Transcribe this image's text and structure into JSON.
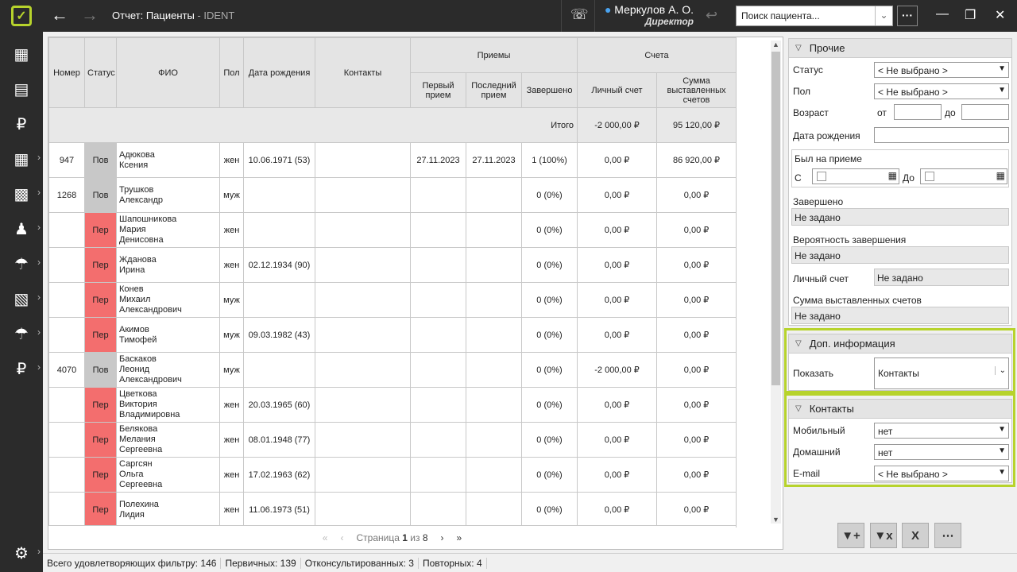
{
  "app": {
    "title": "Отчет: Пациенты",
    "subtitle": " - IDENT",
    "user_name": "Меркулов А. О.",
    "user_role": "Директор",
    "search_placeholder": "Поиск пациента...",
    "more_label": "···"
  },
  "grid": {
    "headers": {
      "num": "Номер",
      "status": "Статус",
      "fio": "ФИО",
      "sex": "Пол",
      "dob": "Дата рождения",
      "contacts": "Контакты",
      "visits": "Приемы",
      "first": "Первый прием",
      "last": "Последний прием",
      "done": "Завершено",
      "bills": "Счета",
      "account": "Личный счет",
      "sum": "Сумма выставленных счетов"
    },
    "total": {
      "label": "Итого",
      "account": "-2 000,00 ₽",
      "sum": "95 120,00 ₽"
    },
    "rows": [
      {
        "num": "947",
        "status": "Пов",
        "type": "pov",
        "fio": "Адюкова\nКсения",
        "sex": "жен",
        "dob": "10.06.1971 (53)",
        "first": "27.11.2023",
        "last": "27.11.2023",
        "done": "1 (100%)",
        "account": "0,00 ₽",
        "sum": "86 920,00 ₽"
      },
      {
        "num": "1268",
        "status": "Пов",
        "type": "pov",
        "fio": "Трушков\nАлександр",
        "sex": "муж",
        "dob": "",
        "first": "",
        "last": "",
        "done": "0 (0%)",
        "account": "0,00 ₽",
        "sum": "0,00 ₽"
      },
      {
        "num": "",
        "status": "Пер",
        "type": "per",
        "fio": "Шапошникова\nМария\nДенисовна",
        "sex": "жен",
        "dob": "",
        "first": "",
        "last": "",
        "done": "0 (0%)",
        "account": "0,00 ₽",
        "sum": "0,00 ₽"
      },
      {
        "num": "",
        "status": "Пер",
        "type": "per",
        "fio": "Жданова\nИрина",
        "sex": "жен",
        "dob": "02.12.1934 (90)",
        "first": "",
        "last": "",
        "done": "0 (0%)",
        "account": "0,00 ₽",
        "sum": "0,00 ₽"
      },
      {
        "num": "",
        "status": "Пер",
        "type": "per",
        "fio": "Конев\nМихаил\nАлександрович",
        "sex": "муж",
        "dob": "",
        "first": "",
        "last": "",
        "done": "0 (0%)",
        "account": "0,00 ₽",
        "sum": "0,00 ₽"
      },
      {
        "num": "",
        "status": "Пер",
        "type": "per",
        "fio": "Акимов\nТимофей",
        "sex": "муж",
        "dob": "09.03.1982 (43)",
        "first": "",
        "last": "",
        "done": "0 (0%)",
        "account": "0,00 ₽",
        "sum": "0,00 ₽"
      },
      {
        "num": "4070",
        "status": "Пов",
        "type": "pov",
        "fio": "Баскаков\nЛеонид\nАлександрович",
        "sex": "муж",
        "dob": "",
        "first": "",
        "last": "",
        "done": "0 (0%)",
        "account": "-2 000,00 ₽",
        "sum": "0,00 ₽"
      },
      {
        "num": "",
        "status": "Пер",
        "type": "per",
        "fio": "Цветкова\nВиктория\nВладимировна",
        "sex": "жен",
        "dob": "20.03.1965 (60)",
        "first": "",
        "last": "",
        "done": "0 (0%)",
        "account": "0,00 ₽",
        "sum": "0,00 ₽"
      },
      {
        "num": "",
        "status": "Пер",
        "type": "per",
        "fio": "Белякова\nМелания\nСергеевна",
        "sex": "жен",
        "dob": "08.01.1948 (77)",
        "first": "",
        "last": "",
        "done": "0 (0%)",
        "account": "0,00 ₽",
        "sum": "0,00 ₽"
      },
      {
        "num": "",
        "status": "Пер",
        "type": "per",
        "fio": "Саргсян\nОльга\nСергеевна",
        "sex": "жен",
        "dob": "17.02.1963 (62)",
        "first": "",
        "last": "",
        "done": "0 (0%)",
        "account": "0,00 ₽",
        "sum": "0,00 ₽"
      },
      {
        "num": "",
        "status": "Пер",
        "type": "per",
        "fio": "Полехина\nЛидия",
        "sex": "жен",
        "dob": "11.06.1973 (51)",
        "first": "",
        "last": "",
        "done": "0 (0%)",
        "account": "0,00 ₽",
        "sum": "0,00 ₽"
      }
    ]
  },
  "pager": {
    "text_prefix": "Страница",
    "current": "1",
    "of": "из",
    "total": "8"
  },
  "statusbar": {
    "total": "Всего удовлетворяющих фильтру: 146",
    "primary": "Первичных: 139",
    "consulted": "Отконсультированных: 3",
    "repeat": "Повторных: 4"
  },
  "filters": {
    "other": {
      "title": "Прочие",
      "status_label": "Статус",
      "status_value": "< Не выбрано >",
      "sex_label": "Пол",
      "sex_value": "< Не выбрано >",
      "age_label": "Возраст",
      "age_from": "от",
      "age_to": "до",
      "dob_label": "Дата рождения",
      "visited_label": "Был на приеме",
      "visited_from": "С",
      "visited_to": "До",
      "done_label": "Завершено",
      "done_value": "Не задано",
      "prob_label": "Вероятность завершения",
      "prob_value": "Не задано",
      "account_label": "Личный счет",
      "account_value": "Не задано",
      "sum_label": "Сумма выставленных счетов",
      "sum_value": "Не задано"
    },
    "extra": {
      "title": "Доп. информация",
      "show_label": "Показать",
      "show_value": "Контакты"
    },
    "contacts": {
      "title": "Контакты",
      "mobile_label": "Мобильный",
      "mobile_value": "нет",
      "home_label": "Домашний",
      "home_value": "нет",
      "email_label": "E-mail",
      "email_value": "< Не выбрано >"
    }
  }
}
